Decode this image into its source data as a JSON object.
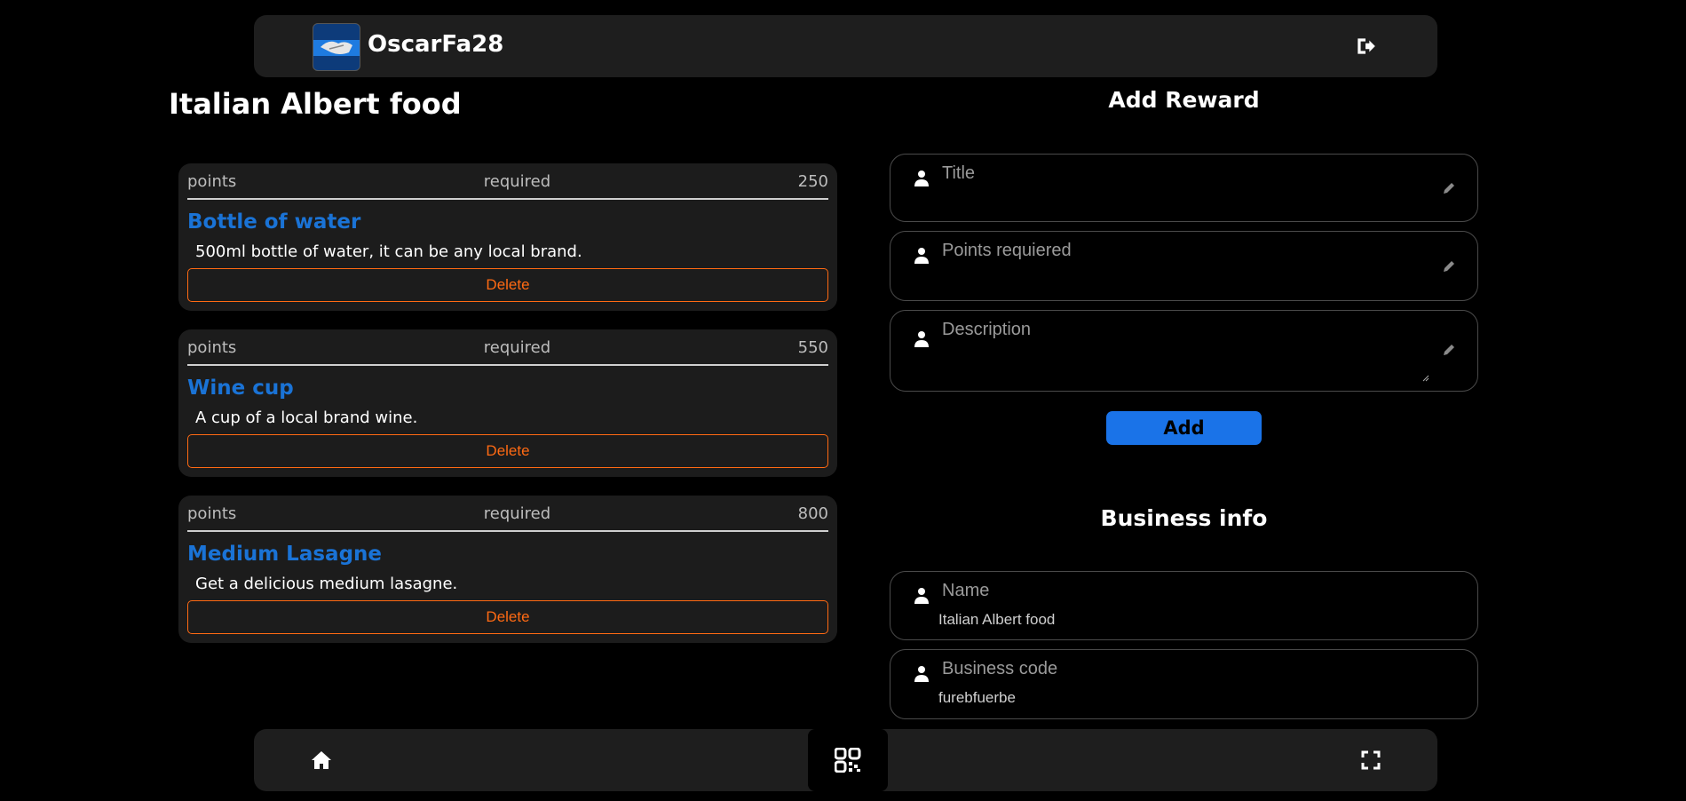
{
  "header": {
    "username": "OscarFa28"
  },
  "page": {
    "title": "Italian Albert food"
  },
  "rewards": [
    {
      "col1": "points",
      "col2": "required",
      "points": "250",
      "title": "Bottle of water",
      "description": "500ml bottle of water, it can be any local brand.",
      "delete_label": "Delete"
    },
    {
      "col1": "points",
      "col2": "required",
      "points": "550",
      "title": "Wine cup",
      "description": "A cup of a local brand wine.",
      "delete_label": "Delete"
    },
    {
      "col1": "points",
      "col2": "required",
      "points": "800",
      "title": "Medium Lasagne",
      "description": "Get a delicious medium lasagne.",
      "delete_label": "Delete"
    }
  ],
  "add_reward": {
    "heading": "Add Reward",
    "title_label": "Title",
    "points_label": "Points requiered",
    "description_label": "Description",
    "add_label": "Add"
  },
  "business_info": {
    "heading": "Business info",
    "name_label": "Name",
    "name_value": "Italian Albert food",
    "code_label": "Business code",
    "code_value": "furebfuerbe"
  },
  "colors": {
    "accent": "#1a73e8",
    "delete": "#ff6a13",
    "card_bg": "#1c1c1c",
    "bar_bg": "#1e1e1e"
  },
  "icons": {
    "logout": "logout-icon",
    "home": "home-icon",
    "qr": "qr-code-icon",
    "scan": "fullscreen-scan-icon",
    "person": "person-icon",
    "pencil": "pencil-icon"
  }
}
